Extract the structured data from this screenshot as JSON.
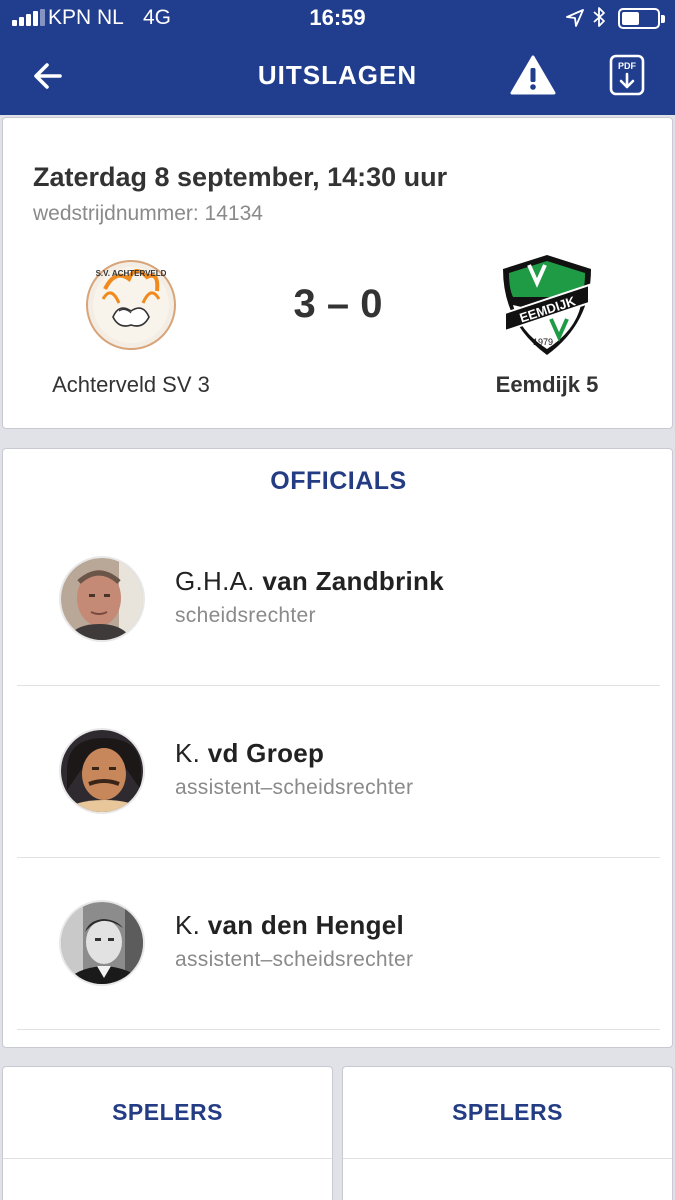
{
  "status_bar": {
    "carrier": "KPN NL",
    "network": "4G",
    "time": "16:59",
    "battery_level": 0.5
  },
  "header": {
    "title": "UITSLAGEN",
    "back_icon": "arrow-left-icon",
    "report_icon": "warning-icon",
    "pdf_icon": "pdf-download-icon",
    "pdf_icon_text": "PDF",
    "background": "#213d8e"
  },
  "match": {
    "date": "Zaterdag 8 september, 14:30 uur",
    "match_number": "wedstrijdnummer: 14134",
    "score": "3 – 0",
    "home_team": "Achterveld SV 3",
    "away_team": "Eemdijk 5",
    "home_logo_text": "S.V. ACHTERVELD",
    "away_logo_text": "EEMDIJK",
    "away_logo_year": "1979"
  },
  "officials": {
    "heading": "OFFICIALS",
    "people": [
      {
        "initials": "G.H.A.",
        "name": "van Zandbrink",
        "role": "scheidsrechter"
      },
      {
        "initials": "K.",
        "name": "vd Groep",
        "role": "assistent–scheidsrechter"
      },
      {
        "initials": "K.",
        "name": "van den Hengel",
        "role": "assistent–scheidsrechter"
      }
    ]
  },
  "players": {
    "home_heading": "SPELERS",
    "away_heading": "SPELERS"
  },
  "colors": {
    "brand_blue": "#213d8e",
    "heading_blue": "#233c84",
    "eemdijk_green": "#1f9a45"
  }
}
